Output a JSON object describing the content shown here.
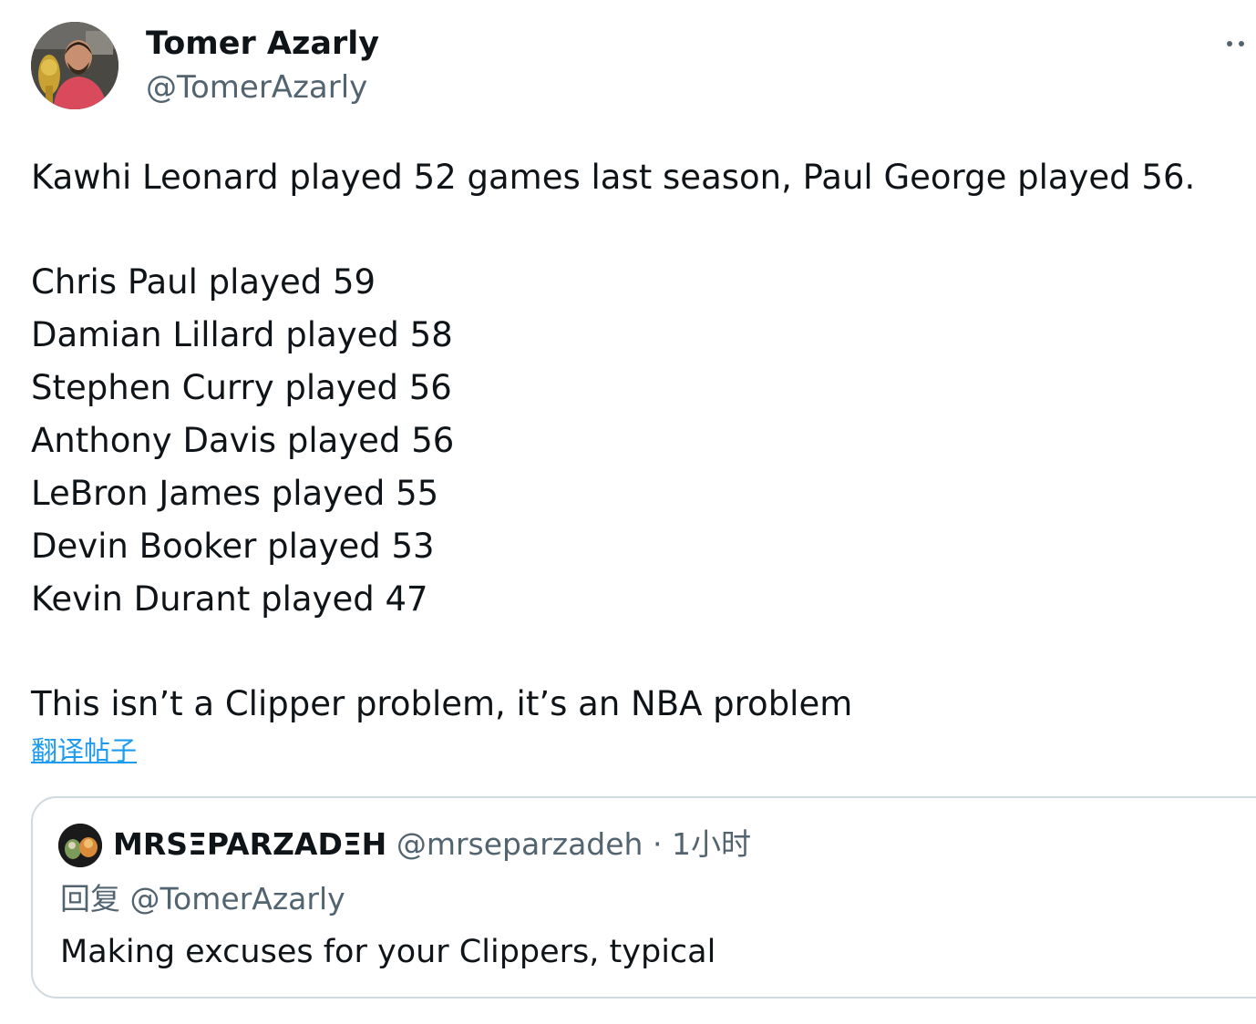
{
  "author": {
    "name": "Tomer Azarly",
    "handle": "@TomerAzarly"
  },
  "tweet": {
    "intro": "Kawhi Leonard played 52 games last season, Paul George played 56.",
    "list": [
      "Chris Paul played 59",
      "Damian Lillard played 58",
      "Stephen Curry played 56",
      "Anthony Davis played 56",
      "LeBron James played 55",
      "Devin Booker played 53",
      "Kevin Durant played 47"
    ],
    "conclusion": "This isn’t a Clipper problem, it’s an NBA problem",
    "translate_label": "翻译帖子"
  },
  "quote": {
    "name": "MRSΞPARZADΞH",
    "handle": "@mrseparzadeh",
    "separator": "·",
    "time": "1小时",
    "reply_prefix": "回复",
    "reply_to": "@TomerAzarly",
    "text": "Making excuses for your Clippers, typical"
  },
  "icons": {
    "more": "more-horizontal-icon"
  },
  "colors": {
    "text": "#0f1419",
    "secondary": "#536471",
    "link": "#1d9bf0",
    "border": "#cfd9de"
  }
}
